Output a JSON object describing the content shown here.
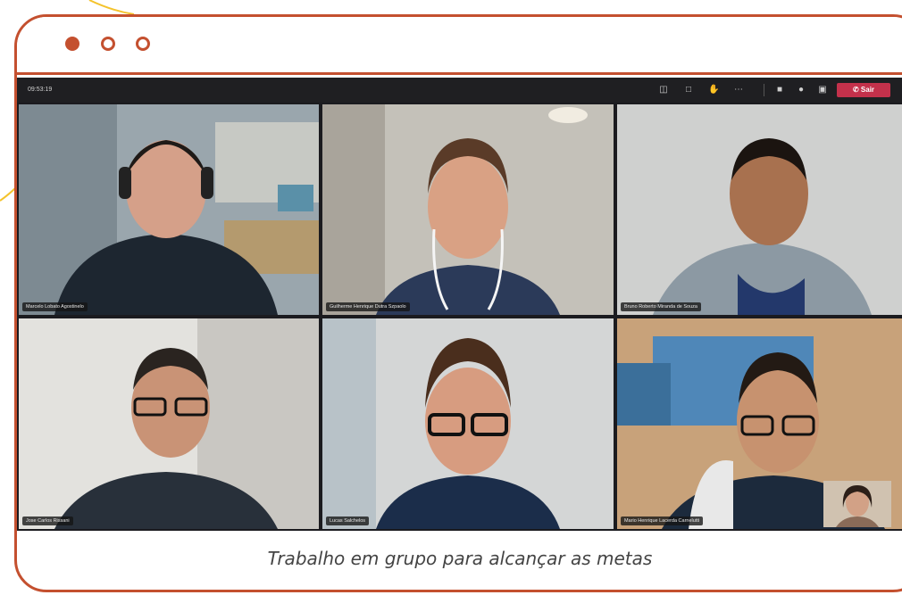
{
  "window": {
    "controls": [
      "close-dot",
      "minimize-dot",
      "maximize-dot"
    ],
    "accent_color": "#c4502f",
    "decoration_color": "#f4c32c"
  },
  "meeting": {
    "timer": "09:53:19",
    "leave_label": "Sair",
    "participants": [
      {
        "name": "Marcelo Lobato Agostinelo"
      },
      {
        "name": "Guilherme Henrique Dutra Szpaolo"
      },
      {
        "name": "Bruno Roberto Miranda de Souza"
      },
      {
        "name": "Jose Carlos Rissani"
      },
      {
        "name": "Lucas Salchelos"
      },
      {
        "name": "Mario Henrique Lacerda Carnelutti"
      }
    ]
  },
  "caption": "Trabalho em grupo para alcançar as metas"
}
